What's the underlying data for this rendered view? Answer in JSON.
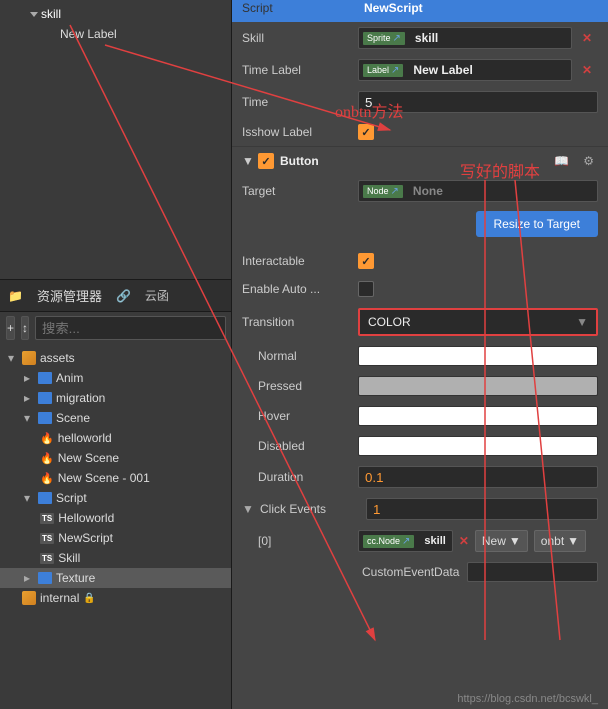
{
  "hierarchy": {
    "skill": "skill",
    "newLabel": "New Label"
  },
  "assetManager": {
    "title": "资源管理器",
    "cloudTab": "云函",
    "searchPlaceholder": "搜索...",
    "tree": {
      "assets": "assets",
      "anim": "Anim",
      "migration": "migration",
      "scene": "Scene",
      "helloworld": "helloworld",
      "newScene": "New Scene",
      "newScene001": "New Scene - 001",
      "script": "Script",
      "scriptHelloworld": "Helloworld",
      "scriptNewScript": "NewScript",
      "scriptSkill": "Skill",
      "texture": "Texture",
      "internal": "internal"
    }
  },
  "inspector": {
    "script": {
      "label": "Script",
      "tag": "",
      "value": "NewScript"
    },
    "skill": {
      "label": "Skill",
      "tag": "Sprite",
      "value": "skill"
    },
    "timeLabel": {
      "label": "Time Label",
      "tag": "Label",
      "value": "New Label"
    },
    "time": {
      "label": "Time",
      "value": "5"
    },
    "isshow": {
      "label": "Isshow Label"
    },
    "button": {
      "title": "Button",
      "target": {
        "label": "Target",
        "tag": "Node",
        "value": "None"
      },
      "resize": "Resize to Target",
      "interactable": "Interactable",
      "enableAuto": "Enable Auto ...",
      "transition": {
        "label": "Transition",
        "value": "COLOR"
      },
      "normal": "Normal",
      "pressed": "Pressed",
      "hover": "Hover",
      "disabled": "Disabled",
      "duration": {
        "label": "Duration",
        "value": "0.1"
      },
      "clickEvents": {
        "label": "Click Events",
        "value": "1"
      },
      "event0": {
        "label": "[0]",
        "tag": "cc.Node",
        "node": "skill",
        "comp": "New",
        "handler": "onbt"
      },
      "customData": "CustomEventData"
    }
  },
  "annotations": {
    "onbtn": "onbtn方法",
    "script": "写好的脚本"
  },
  "watermark": "https://blog.csdn.net/bcswkl_"
}
